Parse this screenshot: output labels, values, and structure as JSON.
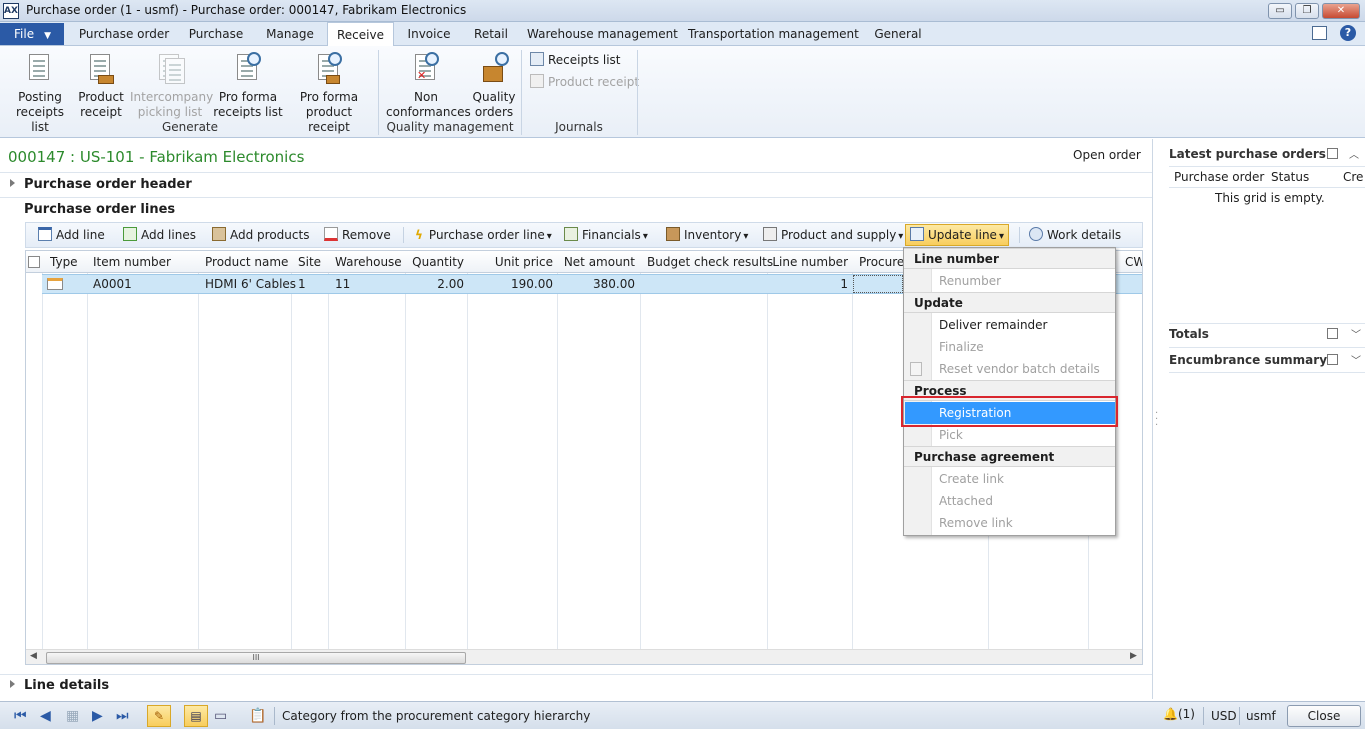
{
  "window": {
    "title": "Purchase order (1 - usmf) - Purchase order: 000147, Fabrikam Electronics",
    "app_icon": "AX",
    "minimize": "▭",
    "restore": "❐",
    "close": "✕"
  },
  "tabs": {
    "file": "File",
    "items": [
      "Purchase order",
      "Purchase",
      "Manage",
      "Receive",
      "Invoice",
      "Retail",
      "Warehouse management",
      "Transportation management",
      "General"
    ],
    "active": "Receive"
  },
  "ribbon": {
    "generate": {
      "group": "Generate",
      "buttons": [
        {
          "line1": "Posting",
          "line2": "receipts list"
        },
        {
          "line1": "Product",
          "line2": "receipt"
        },
        {
          "line1": "Intercompany",
          "line2": "picking list"
        },
        {
          "line1": "Pro forma",
          "line2": "receipts list"
        },
        {
          "line1": "Pro forma",
          "line2": "product receipt"
        }
      ]
    },
    "quality": {
      "group": "Quality management",
      "buttons": [
        {
          "line1": "Non",
          "line2": "conformances"
        },
        {
          "line1": "Quality",
          "line2": "orders"
        }
      ]
    },
    "journals": {
      "group": "Journals",
      "receipts_list": "Receipts list",
      "product_receipt": "Product receipt"
    }
  },
  "main": {
    "title": "000147 : US-101 - Fabrikam Electronics",
    "status": "Open order",
    "header_section": "Purchase order header",
    "lines_section": "Purchase order lines",
    "line_details": "Line details"
  },
  "toolbar": {
    "add_line": "Add line",
    "add_lines": "Add lines",
    "add_products": "Add products",
    "remove": "Remove",
    "po_line": "Purchase order line",
    "financials": "Financials",
    "inventory": "Inventory",
    "product_supply": "Product and supply",
    "update_line": "Update line",
    "work_details": "Work details"
  },
  "grid": {
    "columns": [
      "Type",
      "Item number",
      "Product name",
      "Site",
      "Warehouse",
      "Quantity",
      "Unit price",
      "Net amount",
      "Budget check results",
      "Line number",
      "Procurem",
      "CW"
    ],
    "rows": [
      {
        "item": "A0001",
        "product": "HDMI 6' Cables",
        "site": "1",
        "warehouse": "11",
        "quantity": "2.00",
        "unit_price": "190.00",
        "net_amount": "380.00",
        "budget": "",
        "line_number": "1"
      }
    ],
    "scroll_grip": "III"
  },
  "menu": {
    "line_number": {
      "header": "Line number",
      "items": [
        "Renumber"
      ]
    },
    "update": {
      "header": "Update",
      "items": [
        "Deliver remainder",
        "Finalize",
        "Reset vendor batch details"
      ]
    },
    "process": {
      "header": "Process",
      "items": [
        "Registration",
        "Pick"
      ]
    },
    "agreement": {
      "header": "Purchase agreement",
      "items": [
        "Create link",
        "Attached",
        "Remove link"
      ]
    },
    "highlighted": "Registration"
  },
  "right_pane": {
    "latest_title": "Latest purchase orders",
    "columns": [
      "Purchase order",
      "Status",
      "Cre"
    ],
    "empty_text": "This grid is empty.",
    "totals": "Totals",
    "encumbrance": "Encumbrance summary"
  },
  "status": {
    "text": "Category from the procurement category hierarchy",
    "alerts": "(1)",
    "currency": "USD",
    "company": "usmf",
    "close": "Close"
  },
  "colors": {
    "accent": "#2b5aa6",
    "title_green": "#2c8a2c",
    "selection": "#3399ff",
    "highlight_box": "#d9262e"
  }
}
